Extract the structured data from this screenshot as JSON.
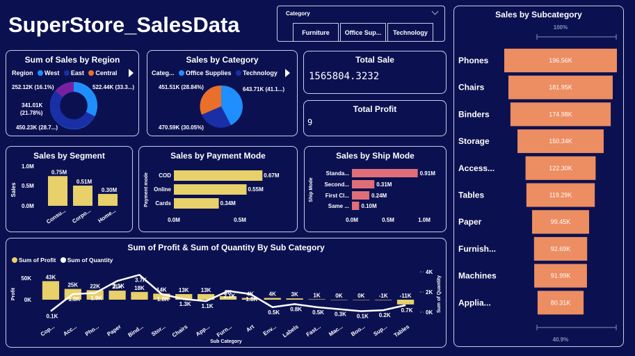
{
  "title": "SuperStore_SalesData",
  "slicer": {
    "label": "Category",
    "options": [
      "Furniture",
      "Office Sup...",
      "Technology"
    ]
  },
  "region": {
    "title": "Sum of Sales by Region",
    "legend_label": "Region",
    "legend": [
      {
        "name": "West",
        "color": "#1f8fff"
      },
      {
        "name": "East",
        "color": "#1a2fa5"
      },
      {
        "name": "Central",
        "color": "#e8702a"
      }
    ],
    "labels": [
      "252.12K (16.1%)",
      "522.44K (33.3...)",
      "341.01K",
      "(21.78%)",
      "450.23K (28.7...)"
    ]
  },
  "category": {
    "title": "Sales by Category",
    "legend_label": "Categ...",
    "legend": [
      {
        "name": "Office Supplies",
        "color": "#1f8fff"
      },
      {
        "name": "Technology",
        "color": "#1a2fa5"
      }
    ],
    "labels": [
      "451.51K (28.84%)",
      "643.71K (41.1...)",
      "470.59K (30.05%)"
    ]
  },
  "total_sale": {
    "title": "Total Sale",
    "value": "1565804.3232"
  },
  "total_profit": {
    "title": "Total Profit",
    "value": "9"
  },
  "segment": {
    "title": "Sales by Segment",
    "ylabel": "Sales",
    "ticks": [
      "1.0M",
      "0.5M",
      "0.0M"
    ],
    "categories": [
      "Consu...",
      "Corpo...",
      "Home..."
    ],
    "values": [
      0.75,
      0.51,
      0.3
    ],
    "value_labels": [
      "0.75M",
      "0.51M",
      "0.30M"
    ]
  },
  "payment": {
    "title": "Sales by Payment Mode",
    "ylabel": "Payment mode",
    "categories": [
      "COD",
      "Online",
      "Cards"
    ],
    "values": [
      0.67,
      0.55,
      0.34
    ],
    "value_labels": [
      "0.67M",
      "0.55M",
      "0.34M"
    ],
    "ticks": [
      "0.0M",
      "0.5M"
    ]
  },
  "ship": {
    "title": "Sales by Ship Mode",
    "ylabel": "Ship Mode",
    "categories": [
      "Standa...",
      "Second...",
      "First Cl...",
      "Same ..."
    ],
    "values": [
      0.91,
      0.31,
      0.24,
      0.1
    ],
    "value_labels": [
      "0.91M",
      "0.31M",
      "0.24M",
      "0.10M"
    ],
    "ticks": [
      "0.0M",
      "0.5M",
      "1.0M"
    ]
  },
  "subcat_funnel": {
    "title": "Sales by Subcategory",
    "top_pct": "100%",
    "bottom_pct": "40.9%",
    "categories": [
      "Phones",
      "Chairs",
      "Binders",
      "Storage",
      "Access...",
      "Tables",
      "Paper",
      "Furnish...",
      "Machines",
      "Applia..."
    ],
    "values": [
      196.56,
      181.95,
      174.98,
      150.34,
      122.3,
      119.29,
      99.45,
      92.69,
      91.99,
      80.31
    ],
    "value_labels": [
      "196.56K",
      "181.95K",
      "174.98K",
      "150.34K",
      "122.30K",
      "119.29K",
      "99.45K",
      "92.69K",
      "91.99K",
      "80.31K"
    ]
  },
  "chart_data": [
    {
      "type": "bar",
      "title": "Sum of Profit & Sum of Quantity By Sub Category",
      "xlabel": "Sub Category",
      "ylabel": "Profit",
      "y2label": "Sum of Quantity",
      "legend": [
        "Sum of Profit",
        "Sum of Quantity"
      ],
      "categories": [
        "Cop...",
        "Acc...",
        "Pho...",
        "Paper",
        "Bind...",
        "Stor...",
        "Chairs",
        "App...",
        "Furn...",
        "Art",
        "Env...",
        "Labels",
        "Fast...",
        "Mac...",
        "Boo...",
        "Sup...",
        "Tables"
      ],
      "series": [
        {
          "name": "Sum of Profit",
          "values": [
            43,
            25,
            22,
            21,
            18,
            14,
            13,
            13,
            8,
            4,
            4,
            3,
            1,
            0,
            0,
            -1,
            -11
          ],
          "labels": [
            "43K",
            "25K",
            "22K",
            "21K",
            "18K",
            "14K",
            "13K",
            "13K",
            "8K",
            "4K",
            "4K",
            "3K",
            "1K",
            "0K",
            "0K",
            "-1K",
            "-11K"
          ]
        },
        {
          "name": "Sum of Quantity",
          "values": [
            0.1,
            1.8,
            1.9,
            3.1,
            3.7,
            1.8,
            1.3,
            1.1,
            2.1,
            1.8,
            0.5,
            0.8,
            0.5,
            0.3,
            0.1,
            0.2,
            0.7
          ],
          "labels": [
            "0.1K",
            "1.8K",
            "1.9K",
            "3.1K",
            "3.7K",
            "1.8K",
            "1.3K",
            "1.1K",
            "2.1K",
            "1.8K",
            "0.5K",
            "0.8K",
            "0.5K",
            "0.3K",
            "0.1K",
            "0.2K",
            "0.7K"
          ]
        }
      ],
      "y_ticks": [
        "50K",
        "0K"
      ],
      "y2_ticks": [
        "4K",
        "2K",
        "0K"
      ],
      "ylim": [
        -15,
        55
      ],
      "y2lim": [
        0,
        4.5
      ],
      "colors": {
        "profit": "#e8d06a",
        "quantity": "#ffffff"
      }
    }
  ]
}
